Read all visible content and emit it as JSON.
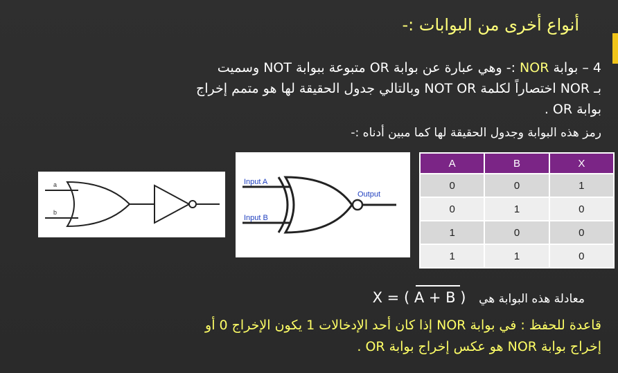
{
  "title": "أنواع أخرى من البوابات :-",
  "p1": {
    "prefix": "4 – بوابة ",
    "nor": "NOR",
    "rest": " :- وهي عبارة عن بوابة OR متبوعة ببوابة NOT وسميت"
  },
  "p2": "بـ NOR اختصاراً لكلمة NOT OR وبالتالي جدول الحقيقة لها هو متمم إخراج",
  "p3": "بوابة OR .",
  "p4": "رمز هذه البوابة وجدول الحقيقة لها كما مبين أدناه :-",
  "diagram1": {
    "label_a": "a",
    "label_b": "b"
  },
  "diagram2": {
    "input_a": "Input A",
    "input_b": "Input B",
    "output": "Output"
  },
  "table": {
    "headers": [
      "A",
      "B",
      "X"
    ],
    "rows": [
      [
        "0",
        "0",
        "1"
      ],
      [
        "0",
        "1",
        "0"
      ],
      [
        "1",
        "0",
        "0"
      ],
      [
        "1",
        "1",
        "0"
      ]
    ]
  },
  "equation": {
    "label": "معادلة هذه البوابة هي",
    "expr": "X = ( A  +  B )"
  },
  "rule1": "قاعدة للحفظ : في بوابة NOR إذا كان أحد الإدخالات 1 يكون الإخراج 0 أو",
  "rule2": "إخراج بوابة NOR هو عكس إخراج بوابة OR ."
}
